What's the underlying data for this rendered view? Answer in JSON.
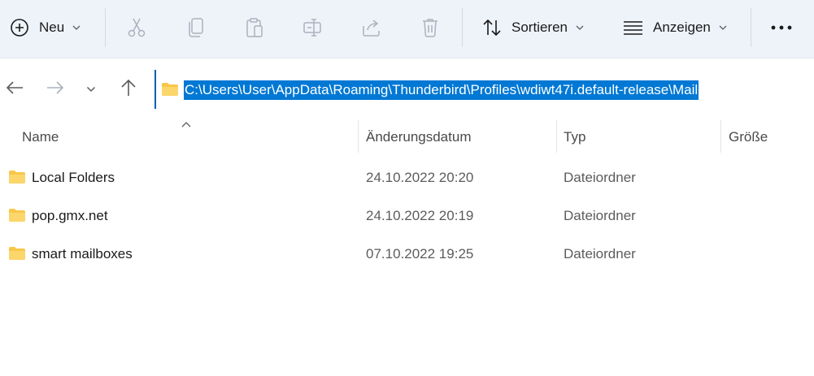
{
  "toolbar": {
    "new_label": "Neu",
    "sort_label": "Sortieren",
    "view_label": "Anzeigen",
    "icons": {
      "new": "plus-circle-icon",
      "cut": "scissors-icon",
      "copy": "copy-icon",
      "paste": "clipboard-icon",
      "rename": "rename-icon",
      "share": "share-icon",
      "delete": "trash-icon",
      "sort": "sort-arrows-icon",
      "view": "view-lines-icon",
      "more": "more-dots-icon"
    }
  },
  "navigation": {
    "address_path": "C:\\Users\\User\\AppData\\Roaming\\Thunderbird\\Profiles\\wdiwt47i.default-release\\Mail"
  },
  "columns": {
    "name": "Name",
    "date": "Änderungsdatum",
    "type": "Typ",
    "size": "Größe"
  },
  "files": [
    {
      "name": "Local Folders",
      "date": "24.10.2022 20:20",
      "type": "Dateiordner"
    },
    {
      "name": "pop.gmx.net",
      "date": "24.10.2022 20:19",
      "type": "Dateiordner"
    },
    {
      "name": "smart mailboxes",
      "date": "07.10.2022 19:25",
      "type": "Dateiordner"
    }
  ],
  "colors": {
    "accent": "#0078d4",
    "toolbar_bg": "#eef3fa",
    "folder": "#f8c74a",
    "disabled_icon": "#aab2bd"
  }
}
